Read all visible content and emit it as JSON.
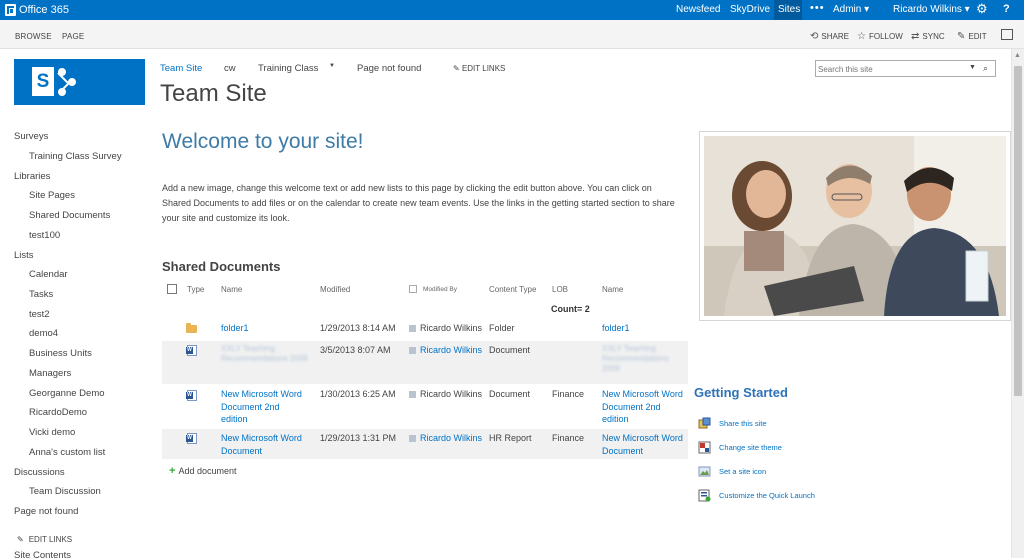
{
  "suitebar": {
    "brand": "Office 365",
    "links": [
      "Newsfeed",
      "SkyDrive",
      "Sites"
    ],
    "more": "•••",
    "admin": "Admin ▾",
    "user": "Ricardo Wilkins ▾",
    "help": "?"
  },
  "ribbon": {
    "tabs": [
      "BROWSE",
      "PAGE"
    ],
    "actions": {
      "share": "SHARE",
      "follow": "FOLLOW",
      "sync": "SYNC",
      "edit": "EDIT"
    }
  },
  "header": {
    "topnav": [
      "Team Site",
      "cw",
      "Training Class",
      "Page not found"
    ],
    "edit_links": "EDIT LINKS",
    "site_title": "Team Site"
  },
  "search": {
    "placeholder": "Search this site"
  },
  "quicklaunch": {
    "items": [
      {
        "label": "Surveys",
        "level": 0
      },
      {
        "label": "Training Class Survey",
        "level": 1
      },
      {
        "label": "Libraries",
        "level": 0
      },
      {
        "label": "Site Pages",
        "level": 1
      },
      {
        "label": "Shared Documents",
        "level": 1
      },
      {
        "label": "test100",
        "level": 1
      },
      {
        "label": "Lists",
        "level": 0
      },
      {
        "label": "Calendar",
        "level": 1
      },
      {
        "label": "Tasks",
        "level": 1
      },
      {
        "label": "test2",
        "level": 1
      },
      {
        "label": "demo4",
        "level": 1
      },
      {
        "label": "Business Units",
        "level": 1
      },
      {
        "label": "Managers",
        "level": 1
      },
      {
        "label": "Georganne Demo",
        "level": 1
      },
      {
        "label": "RicardoDemo",
        "level": 1
      },
      {
        "label": "Vicki demo",
        "level": 1
      },
      {
        "label": "Anna's custom list",
        "level": 1
      },
      {
        "label": "Discussions",
        "level": 0
      },
      {
        "label": "Team Discussion",
        "level": 1
      },
      {
        "label": "Page not found",
        "level": 0
      }
    ],
    "edit_links": "EDIT LINKS",
    "site_contents": "Site Contents"
  },
  "main": {
    "welcome_title": "Welcome to your site!",
    "welcome_text": "Add a new image, change this welcome text or add new lists to this page by clicking the edit button above. You can click on Shared Documents to add files or on the calendar to create new team events. Use the links in the getting started section to share your site and customize its look."
  },
  "documents": {
    "heading": "Shared Documents",
    "columns": {
      "type": "Type",
      "name": "Name",
      "modified": "Modified",
      "modified_by": "Modified By",
      "content_type": "Content Type",
      "lob": "LOB",
      "name2": "Name"
    },
    "count_label": "Count= 2",
    "rows": [
      {
        "icon": "folder-icon",
        "name": "folder1",
        "modified": "1/29/2013 8:14 AM",
        "modified_by": "Ricardo Wilkins",
        "content_type": "Folder",
        "lob": "",
        "name2": "folder1",
        "obscured": false
      },
      {
        "icon": "word-icon",
        "name": "XXLY Teaching Recommendations 2008",
        "modified": "3/5/2013 8:07 AM",
        "modified_by": "Ricardo Wilkins",
        "content_type": "Document",
        "lob": "",
        "name2": "XXLY Teaching Recommendations 2008",
        "obscured": true
      },
      {
        "icon": "word-icon",
        "name": "New Microsoft Word Document 2nd edition",
        "modified": "1/30/2013 6:25 AM",
        "modified_by": "Ricardo Wilkins",
        "content_type": "Document",
        "lob": "Finance",
        "name2": "New Microsoft Word Document 2nd edition",
        "obscured": false
      },
      {
        "icon": "word-icon",
        "name": "New Microsoft Word Document",
        "modified": "1/29/2013 1:31 PM",
        "modified_by": "Ricardo Wilkins",
        "content_type": "HR Report",
        "lob": "Finance",
        "name2": "New Microsoft Word Document",
        "obscured": false
      }
    ],
    "add_label": "Add document"
  },
  "getting_started": {
    "heading": "Getting Started",
    "items": [
      {
        "label": "Share this site",
        "icon": "share-site-icon"
      },
      {
        "label": "Change site theme",
        "icon": "theme-icon"
      },
      {
        "label": "Set a site icon",
        "icon": "site-icon-icon"
      },
      {
        "label": "Customize the Quick Launch",
        "icon": "quick-launch-icon"
      }
    ]
  },
  "colors": {
    "suite_bar": "#0072c6",
    "link": "#0072c6",
    "heading": "#3e7ba6"
  }
}
